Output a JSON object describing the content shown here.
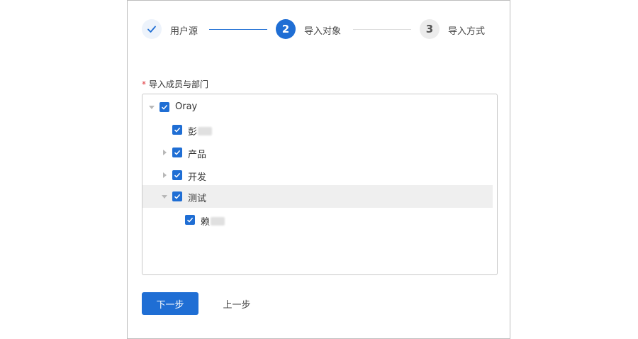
{
  "stepper": {
    "steps": [
      {
        "number": "",
        "label": "用户源",
        "status": "done"
      },
      {
        "number": "2",
        "label": "导入对象",
        "status": "active"
      },
      {
        "number": "3",
        "label": "导入方式",
        "status": "todo"
      }
    ]
  },
  "form": {
    "field_label": "导入成员与部门",
    "required_mark": "*"
  },
  "tree": {
    "nodes": [
      {
        "label": "Oray",
        "expanded": true,
        "checked": true,
        "level": 0,
        "has_children": true
      },
      {
        "label": "彭",
        "checked": true,
        "level": 1,
        "has_children": false,
        "redacted": true
      },
      {
        "label": "产品",
        "expanded": false,
        "checked": true,
        "level": 1,
        "has_children": true
      },
      {
        "label": "开发",
        "expanded": false,
        "checked": true,
        "level": 1,
        "has_children": true
      },
      {
        "label": "测试",
        "expanded": true,
        "checked": true,
        "level": 1,
        "has_children": true,
        "selected": true
      },
      {
        "label": "赖",
        "checked": true,
        "level": 2,
        "has_children": false,
        "redacted": true
      }
    ]
  },
  "actions": {
    "next_label": "下一步",
    "prev_label": "上一步"
  },
  "colors": {
    "primary": "#1f6ed4",
    "required": "#e0393e",
    "selected_row": "#efefef"
  }
}
